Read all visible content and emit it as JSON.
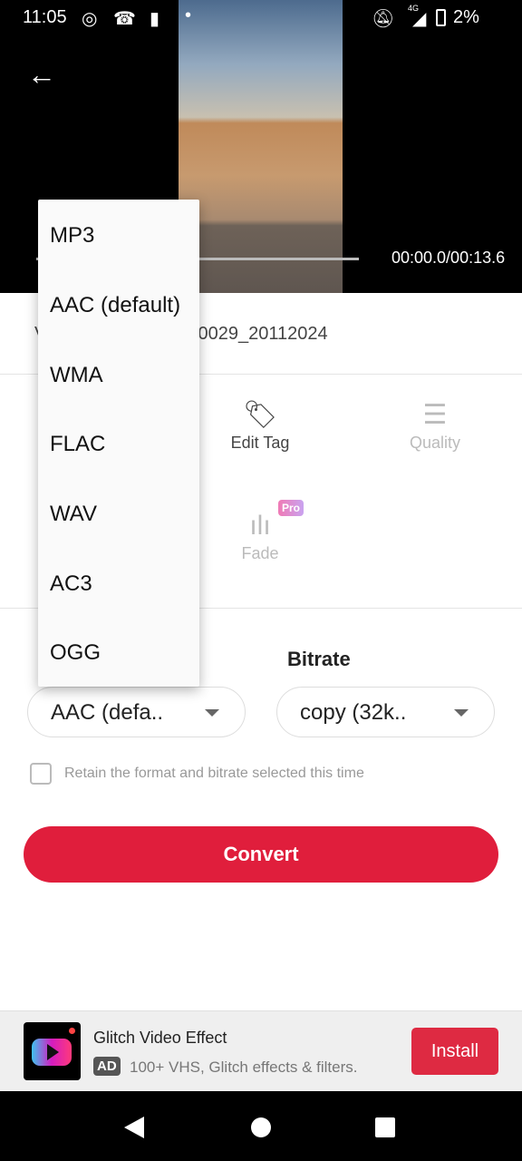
{
  "status_bar": {
    "time": "11:05",
    "battery": "2%",
    "network": "4G",
    "icons": [
      "whatsapp-icon",
      "missed-call-icon",
      "battery-alert-icon",
      "dot-icon",
      "bell-off-icon",
      "signal-icon",
      "battery-icon"
    ]
  },
  "player": {
    "timecode": "00:00.0/00:13.6",
    "progress": 0
  },
  "file": {
    "name_prefix": "V",
    "name_visible": ".0029_20112024"
  },
  "tools": [
    {
      "label": "Edit Tag",
      "icon": "tag-icon"
    },
    {
      "label": "Quality",
      "icon": "sliders-icon"
    },
    {
      "label": "Fade",
      "icon": "waveform-icon",
      "badge": "Pro"
    }
  ],
  "settings": {
    "bitrate_label": "Bitrate",
    "format_value": "AAC (defa..",
    "bitrate_value": "copy (32k..",
    "retain_label": "Retain the format and bitrate selected this time",
    "retain_checked": false
  },
  "convert_label": "Convert",
  "format_menu": {
    "options": [
      "MP3",
      "AAC (default)",
      "WMA",
      "FLAC",
      "WAV",
      "AC3",
      "OGG"
    ]
  },
  "ad": {
    "title": "Glitch Video Effect",
    "badge": "AD",
    "text": "100+ VHS, Glitch effects & filters.",
    "install": "Install"
  },
  "colors": {
    "accent": "#e01e3c",
    "pro_badge": "#f07ab5"
  }
}
